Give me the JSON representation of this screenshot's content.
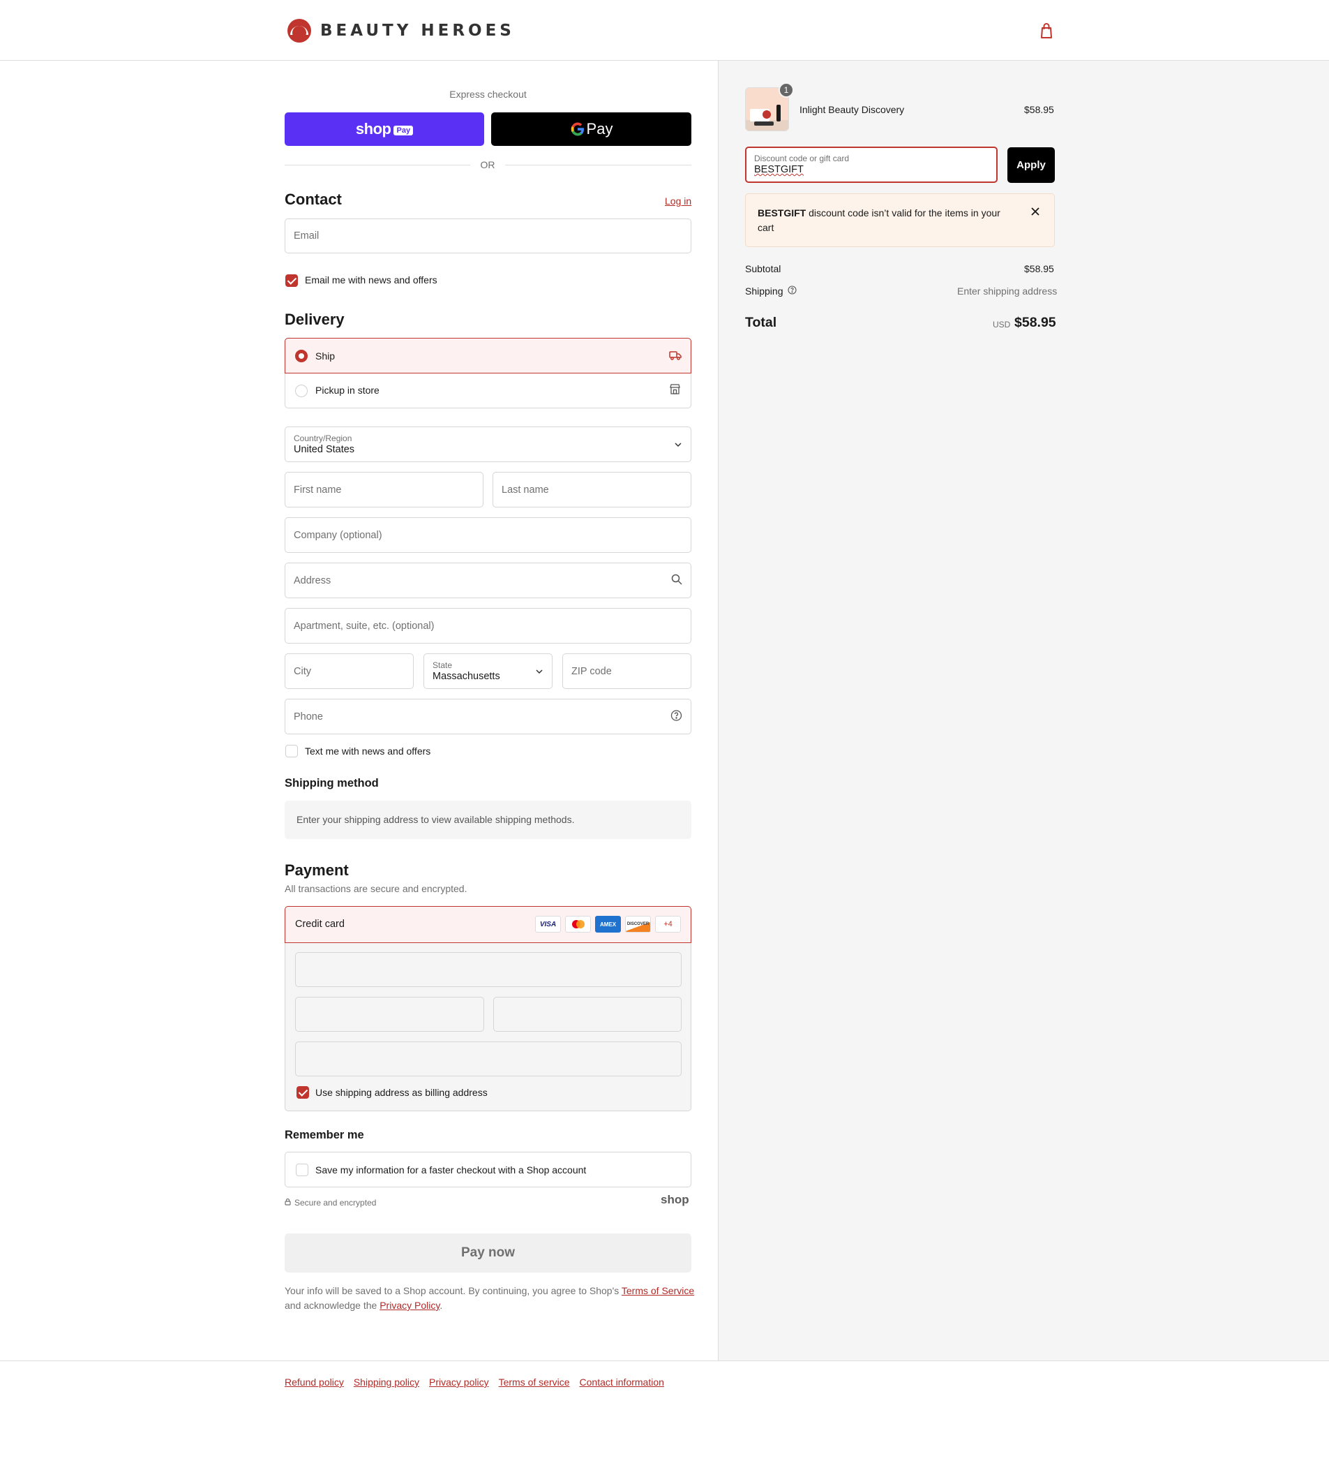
{
  "brand": {
    "name": "BEAUTY HEROES",
    "accent": "#c0352d"
  },
  "express": {
    "title": "Express checkout",
    "shop_pay": {
      "text": "shop",
      "badge": "Pay"
    },
    "google_pay": {
      "text": "Pay"
    },
    "or": "OR"
  },
  "contact": {
    "title": "Contact",
    "login": "Log in",
    "email_placeholder": "Email",
    "news_label": "Email me with news and offers"
  },
  "delivery": {
    "title": "Delivery",
    "options": [
      {
        "label": "Ship",
        "selected": true
      },
      {
        "label": "Pickup in store",
        "selected": false
      }
    ],
    "country_label": "Country/Region",
    "country_value": "United States",
    "first_name": "First name",
    "last_name": "Last name",
    "company": "Company (optional)",
    "address": "Address",
    "apartment": "Apartment, suite, etc. (optional)",
    "city": "City",
    "state_label": "State",
    "state_value": "Massachusetts",
    "zip": "ZIP code",
    "phone": "Phone",
    "text_label": "Text me with news and offers"
  },
  "shipping_method": {
    "title": "Shipping method",
    "message": "Enter your shipping address to view available shipping methods."
  },
  "payment": {
    "title": "Payment",
    "subtitle": "All transactions are secure and encrypted.",
    "method": "Credit card",
    "cards": [
      "VISA",
      "",
      "AMEX",
      "DISCOVER",
      "+4"
    ],
    "billing_label": "Use shipping address as billing address"
  },
  "remember": {
    "title": "Remember me",
    "save_label": "Save my information for a faster checkout with a Shop account",
    "secure": "Secure and encrypted",
    "shop_logo": "shop"
  },
  "pay_now": "Pay now",
  "legal": {
    "part1": "Your info will be saved to a Shop account. By continuing, you agree to Shop's ",
    "terms": "Terms of Service",
    "part2": "and acknowledge the ",
    "privacy": "Privacy Policy",
    "part3": "."
  },
  "footer": [
    "Refund policy",
    "Shipping policy",
    "Privacy policy",
    "Terms of service",
    "Contact information"
  ],
  "summary": {
    "item": {
      "name": "Inlight Beauty Discovery",
      "price": "$58.95",
      "qty": "1"
    },
    "discount_label": "Discount code or gift card",
    "discount_value": "BESTGIFT",
    "apply": "Apply",
    "error_code": "BESTGIFT",
    "error_text": " discount code isn’t valid for the items in your cart",
    "subtotal_label": "Subtotal",
    "subtotal_value": "$58.95",
    "shipping_label": "Shipping",
    "shipping_value": "Enter shipping address",
    "total_label": "Total",
    "currency": "USD",
    "total_value": "$58.95"
  }
}
